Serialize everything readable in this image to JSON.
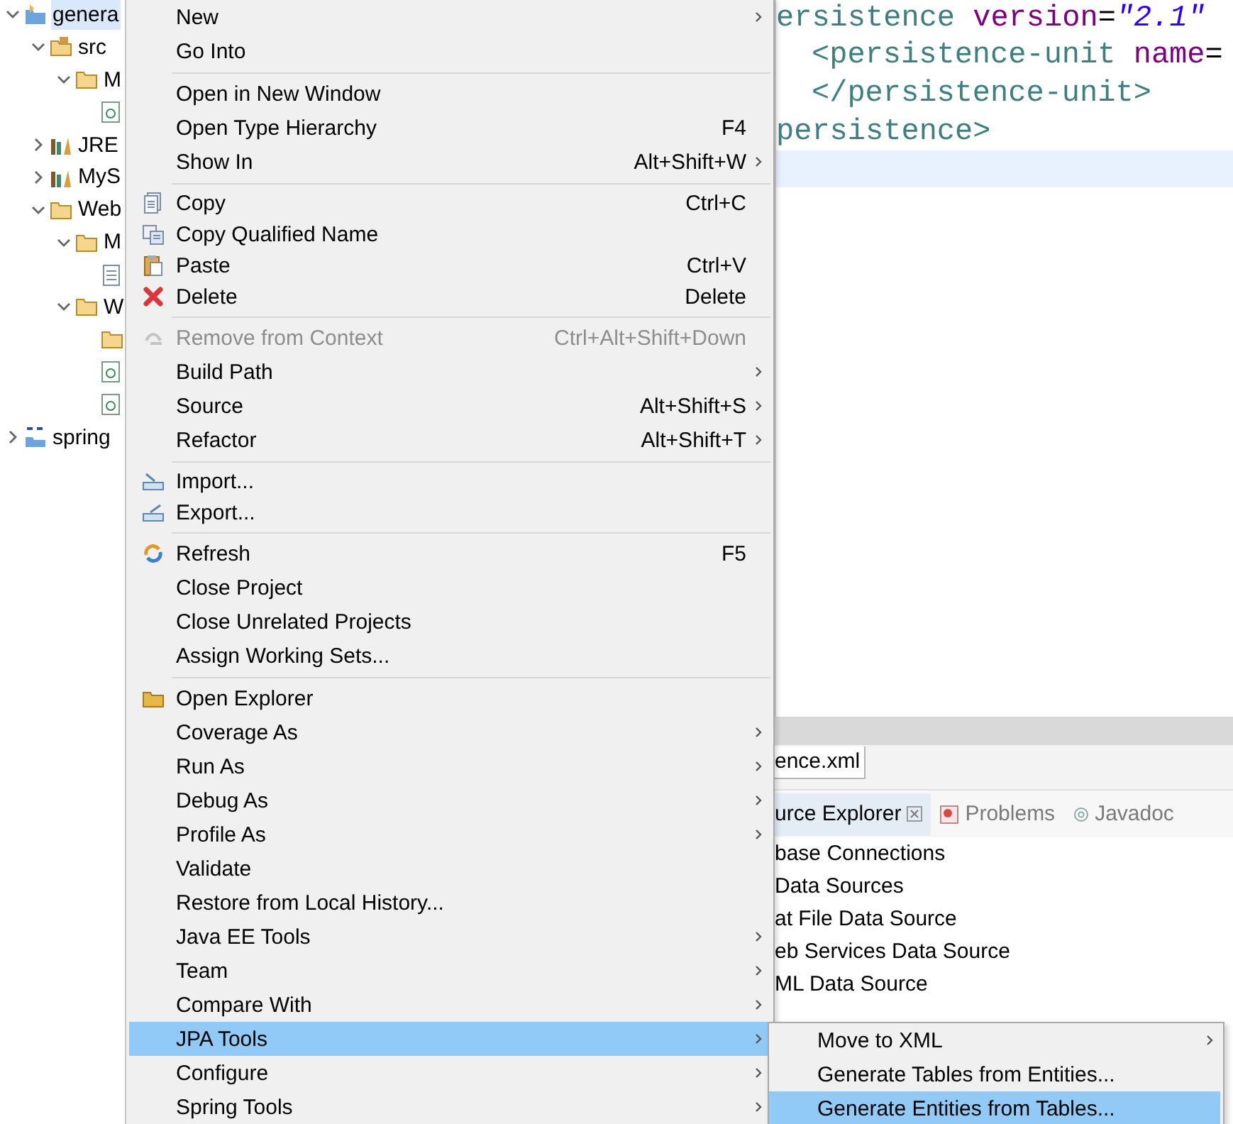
{
  "tree": [
    {
      "label": "genera",
      "kind": "project",
      "expanded": true,
      "selected": true,
      "children": [
        {
          "label": "src",
          "kind": "source",
          "expanded": true,
          "selected": false,
          "children": [
            {
              "label": "M",
              "kind": "folder",
              "expanded": true,
              "selected": false,
              "children": [
                {
                  "kind": "xml",
                  "selected": false
                }
              ]
            }
          ]
        },
        {
          "label": "JRE",
          "kind": "library",
          "expanded": false,
          "selected": false
        },
        {
          "label": "MyS",
          "kind": "library",
          "expanded": false,
          "selected": false
        },
        {
          "label": "Web",
          "kind": "folder",
          "expanded": true,
          "selected": false,
          "children": [
            {
              "label": "M",
              "kind": "folder",
              "expanded": true,
              "selected": false,
              "children": [
                {
                  "kind": "doc",
                  "selected": false
                }
              ]
            },
            {
              "label": "W",
              "kind": "folder",
              "expanded": true,
              "selected": false,
              "children": [
                {
                  "kind": "folder",
                  "selected": false
                },
                {
                  "kind": "xml",
                  "selected": false
                },
                {
                  "kind": "xml",
                  "selected": false
                }
              ]
            }
          ]
        }
      ]
    },
    {
      "label": "spring",
      "kind": "spring",
      "expanded": false,
      "selected": false
    }
  ],
  "menu": [
    [
      {
        "label": "New",
        "kind": "plain",
        "submenu": true,
        "disabled": false,
        "selected": false
      },
      {
        "label": "Go Into",
        "kind": "plain",
        "submenu": false,
        "disabled": false,
        "selected": false
      }
    ],
    [
      {
        "label": "Open in New Window",
        "kind": "plain",
        "submenu": false,
        "disabled": false,
        "selected": false
      },
      {
        "label": "Open Type Hierarchy",
        "kind": "plain",
        "shortcut": "F4",
        "submenu": false,
        "disabled": false,
        "selected": false
      },
      {
        "label": "Show In",
        "kind": "plain",
        "shortcut": "Alt+Shift+W",
        "submenu": true,
        "disabled": false,
        "selected": false
      }
    ],
    [
      {
        "label": "Copy",
        "kind": "copy",
        "shortcut": "Ctrl+C",
        "submenu": false,
        "disabled": false,
        "selected": false
      },
      {
        "label": "Copy Qualified Name",
        "kind": "copy2",
        "submenu": false,
        "disabled": false,
        "selected": false
      },
      {
        "label": "Paste",
        "kind": "paste",
        "shortcut": "Ctrl+V",
        "submenu": false,
        "disabled": false,
        "selected": false
      },
      {
        "label": "Delete",
        "kind": "delete",
        "shortcut": "Delete",
        "submenu": false,
        "disabled": false,
        "selected": false
      }
    ],
    [
      {
        "label": "Remove from Context",
        "kind": "remove",
        "shortcut": "Ctrl+Alt+Shift+Down",
        "submenu": false,
        "disabled": true,
        "selected": false
      },
      {
        "label": "Build Path",
        "kind": "plain",
        "submenu": true,
        "disabled": false,
        "selected": false
      },
      {
        "label": "Source",
        "kind": "plain",
        "shortcut": "Alt+Shift+S",
        "submenu": true,
        "disabled": false,
        "selected": false
      },
      {
        "label": "Refactor",
        "kind": "plain",
        "shortcut": "Alt+Shift+T",
        "submenu": true,
        "disabled": false,
        "selected": false
      }
    ],
    [
      {
        "label": "Import...",
        "kind": "import",
        "submenu": false,
        "disabled": false,
        "selected": false
      },
      {
        "label": "Export...",
        "kind": "export",
        "submenu": false,
        "disabled": false,
        "selected": false
      }
    ],
    [
      {
        "label": "Refresh",
        "kind": "refresh",
        "shortcut": "F5",
        "submenu": false,
        "disabled": false,
        "selected": false
      },
      {
        "label": "Close Project",
        "kind": "plain",
        "submenu": false,
        "disabled": false,
        "selected": false
      },
      {
        "label": "Close Unrelated Projects",
        "kind": "plain",
        "submenu": false,
        "disabled": false,
        "selected": false
      },
      {
        "label": "Assign Working Sets...",
        "kind": "plain",
        "submenu": false,
        "disabled": false,
        "selected": false
      }
    ],
    [
      {
        "label": "Open Explorer",
        "kind": "explorer",
        "submenu": false,
        "disabled": false,
        "selected": false
      },
      {
        "label": "Coverage As",
        "kind": "plain",
        "submenu": true,
        "disabled": false,
        "selected": false
      },
      {
        "label": "Run As",
        "kind": "plain",
        "submenu": true,
        "disabled": false,
        "selected": false
      },
      {
        "label": "Debug As",
        "kind": "plain",
        "submenu": true,
        "disabled": false,
        "selected": false
      },
      {
        "label": "Profile As",
        "kind": "plain",
        "submenu": true,
        "disabled": false,
        "selected": false
      },
      {
        "label": "Validate",
        "kind": "plain",
        "submenu": false,
        "disabled": false,
        "selected": false
      },
      {
        "label": "Restore from Local History...",
        "kind": "plain",
        "submenu": false,
        "disabled": false,
        "selected": false
      },
      {
        "label": "Java EE Tools",
        "kind": "plain",
        "submenu": true,
        "disabled": false,
        "selected": false
      },
      {
        "label": "Team",
        "kind": "plain",
        "submenu": true,
        "disabled": false,
        "selected": false
      },
      {
        "label": "Compare With",
        "kind": "plain",
        "submenu": true,
        "disabled": false,
        "selected": false
      },
      {
        "label": "JPA Tools",
        "kind": "plain",
        "submenu": true,
        "disabled": false,
        "selected": true
      },
      {
        "label": "Configure",
        "kind": "plain",
        "submenu": true,
        "disabled": false,
        "selected": false
      },
      {
        "label": "Spring Tools",
        "kind": "plain",
        "submenu": true,
        "disabled": false,
        "selected": false
      }
    ]
  ],
  "submenu": [
    {
      "label": "Move to XML",
      "submenu": true,
      "selected": false
    },
    {
      "label": "Generate Tables from Entities...",
      "submenu": false,
      "selected": false
    },
    {
      "label": "Generate Entities from Tables...",
      "submenu": false,
      "selected": true
    }
  ],
  "editor": {
    "lines": [
      {
        "indented": false,
        "tokens": [
          {
            "kind": "tag",
            "text": "ersistence"
          },
          {
            "kind": "attr",
            "text": "version"
          },
          {
            "kind": "eq",
            "text": "="
          },
          {
            "kind": "value",
            "text": "\"2.1\""
          }
        ]
      },
      {
        "indented": true,
        "tokens": [
          {
            "kind": "tag",
            "text": "<persistence-unit"
          },
          {
            "kind": "attr",
            "text": "name"
          },
          {
            "kind": "eq",
            "text": "="
          }
        ]
      },
      {
        "indented": true,
        "tokens": [
          {
            "kind": "tag",
            "text": "</persistence-unit>"
          }
        ]
      },
      {
        "indented": false,
        "tokens": [
          {
            "kind": "tag",
            "text": "persistence>"
          }
        ]
      }
    ],
    "tab": "ence.xml"
  },
  "panel": {
    "tabs": [
      {
        "label": "urce Explorer",
        "selected": true,
        "closable": true
      },
      {
        "label": "Problems",
        "selected": false,
        "kind": "problems"
      },
      {
        "label": "Javadoc",
        "selected": false,
        "kind": "javadoc"
      }
    ],
    "items": [
      "base Connections",
      " Data Sources",
      "at File Data Source",
      "eb Services Data Source",
      "ML Data Source"
    ]
  }
}
